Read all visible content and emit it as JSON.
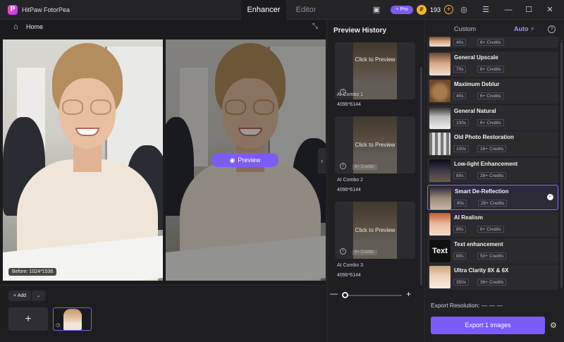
{
  "app": {
    "name": "HitPaw FotorPea",
    "logo_letter": "P"
  },
  "tabs": [
    {
      "label": "Enhancer",
      "active": true
    },
    {
      "label": "Editor",
      "active": false
    }
  ],
  "titlebar": {
    "pro_label": "+ Pro",
    "coin_symbol": "₽",
    "coins": "193",
    "coin_add": "+",
    "icons": [
      "chat-icon",
      "pro-badge",
      "coin-icon",
      "add-coin-icon",
      "user-icon",
      "menu-icon",
      "minimize-icon",
      "maximize-icon",
      "close-icon"
    ],
    "glyphs": {
      "chat": "▣",
      "user": "◎",
      "menu": "☰",
      "minimize": "—",
      "maximize": "☐",
      "close": "✕"
    }
  },
  "toolbar": {
    "home_label": "Home",
    "home_glyph": "⌂",
    "crop_glyph": "⤡"
  },
  "canvas": {
    "before_label": "Before: 1024*1536",
    "preview_label": "Preview",
    "preview_glyph": "◉",
    "next_glyph": "›"
  },
  "bottom": {
    "add_label": "+ Add",
    "add_drop": "⌄",
    "add_tile": "+",
    "thumb_clock": "◷"
  },
  "history": {
    "title": "Preview History",
    "click_label": "Click to Preview",
    "info_glyph": "i",
    "items": [
      {
        "name": "AI Combo 1",
        "size": "4096*6144",
        "credits": ""
      },
      {
        "name": "AI Combo 2",
        "size": "4096*6144",
        "credits": "6+ Credits"
      },
      {
        "name": "AI Combo 3",
        "size": "4096*6144",
        "credits": "6+ Credits"
      }
    ]
  },
  "zoom": {
    "minus": "—",
    "plus": "+",
    "level": 0.0
  },
  "right_panel": {
    "tabs": {
      "custom": "Custom",
      "auto": "Auto ⚡"
    },
    "help": "?",
    "top_partial": {
      "time": "40s",
      "credits": "6+ Credits"
    },
    "models": [
      {
        "name": "General Upscale",
        "time": "70s",
        "credits": "6+ Credits",
        "thumb": "t-portrait",
        "selected": false
      },
      {
        "name": "Maximum Deblur",
        "time": "40s",
        "credits": "6+ Credits",
        "thumb": "t-cat",
        "selected": false
      },
      {
        "name": "General Natural",
        "time": "100s",
        "credits": "6+ Credits",
        "thumb": "t-bw",
        "selected": false
      },
      {
        "name": "Old Photo Restoration",
        "time": "100s",
        "credits": "16+ Credits",
        "thumb": "t-old",
        "selected": false
      },
      {
        "name": "Low-light Enhancement",
        "time": "80s",
        "credits": "28+ Credits",
        "thumb": "t-night",
        "selected": false
      },
      {
        "name": "Smart De-Reflection",
        "time": "80s",
        "credits": "28+ Credits",
        "thumb": "t-refl",
        "selected": true
      },
      {
        "name": "AI Realism",
        "time": "80s",
        "credits": "6+ Credits",
        "thumb": "t-real",
        "selected": false
      },
      {
        "name": "Text enhancement",
        "time": "80s",
        "credits": "50+ Credits",
        "thumb": "t-text",
        "selected": false
      },
      {
        "name": "Ultra Clarity 8X & 6X",
        "time": "350s",
        "credits": "36+ Credits",
        "thumb": "t-ultra",
        "selected": false
      }
    ],
    "text_thumb_label": "Text",
    "export_resolution": "Export Resolution: — — —",
    "export_button": "Export 1 images",
    "settings_glyph": "⚙"
  },
  "colors": {
    "accent": "#7c5cf5",
    "background": "#1b1b1f",
    "panel": "#212125",
    "coin": "#f0b43a"
  }
}
